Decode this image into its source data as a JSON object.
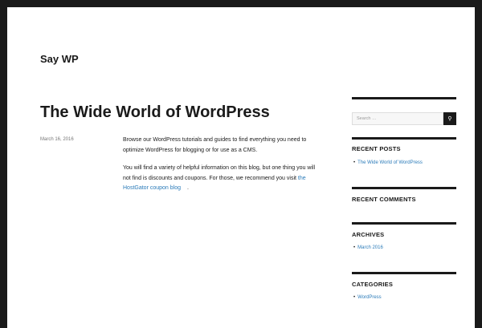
{
  "site": {
    "title": "Say WP"
  },
  "post": {
    "title": "The Wide World of WordPress",
    "date": "March 16, 2016",
    "p1": "Browse our WordPress tutorials and guides to find everything you need to optimize WordPress for blogging or for use as a CMS.",
    "p2": "You will find a variety of helpful information on this blog, but one thing you will not find is discounts and coupons.  For those, we recommend you visit ",
    "link": "the HostGator coupon blog",
    "after": "."
  },
  "sidebar": {
    "search_placeholder": "Search …",
    "search_icon": "search-icon",
    "recent_posts": {
      "heading": "RECENT POSTS",
      "items": [
        "The Wide World of WordPress"
      ]
    },
    "recent_comments": {
      "heading": "RECENT COMMENTS"
    },
    "archives": {
      "heading": "ARCHIVES",
      "items": [
        "March 2016"
      ]
    },
    "categories": {
      "heading": "CATEGORIES",
      "items": [
        "WordPress"
      ]
    }
  }
}
